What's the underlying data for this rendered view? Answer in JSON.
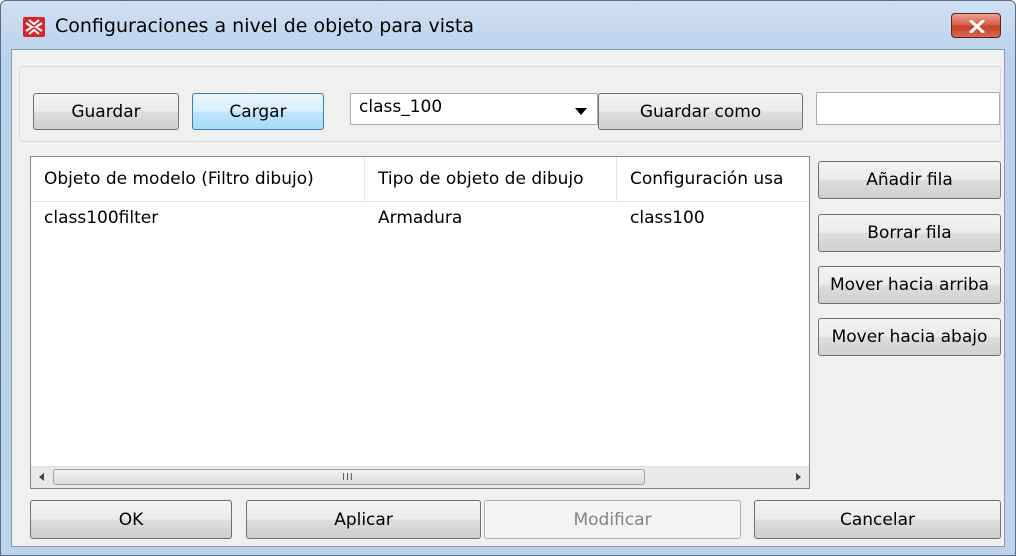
{
  "window": {
    "title": "Configuraciones a nivel de objeto para vista"
  },
  "toolbar": {
    "save_label": "Guardar",
    "load_label": "Cargar",
    "preset_selected": "class_100",
    "save_as_label": "Guardar como",
    "save_as_value": ""
  },
  "table": {
    "columns": [
      "Objeto de modelo (Filtro dibujo)",
      "Tipo de objeto de dibujo",
      "Configuración usa"
    ],
    "rows": [
      [
        "class100filter",
        "Armadura",
        "class100"
      ]
    ],
    "scroll_grip": "III"
  },
  "side_buttons": {
    "add_row": "Añadir fila",
    "delete_row": "Borrar fila",
    "move_up": "Mover hacia arriba",
    "move_down": "Mover hacia abajo"
  },
  "footer": {
    "ok": "OK",
    "apply": "Aplicar",
    "modify": "Modificar",
    "cancel": "Cancelar"
  }
}
